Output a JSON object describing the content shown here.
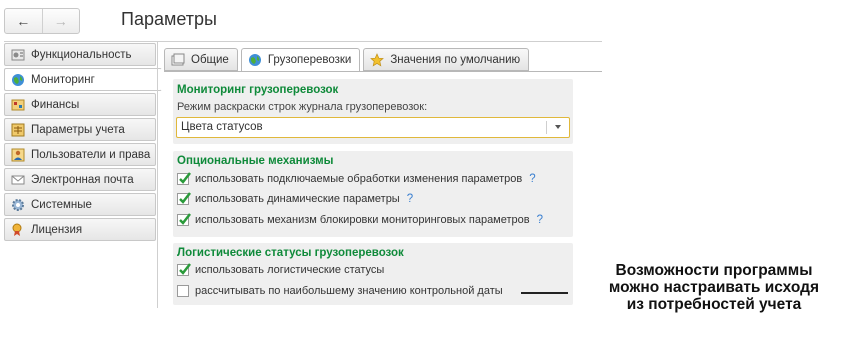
{
  "window": {
    "title": "Параметры"
  },
  "nav": {
    "back_glyph": "←",
    "forward_glyph": "→"
  },
  "sidebar": {
    "items": [
      {
        "label": "Функциональность",
        "icon": "gear-list-icon"
      },
      {
        "label": "Мониторинг",
        "icon": "globe-icon",
        "active": true
      },
      {
        "label": "Финансы",
        "icon": "finance-icon"
      },
      {
        "label": "Параметры учета",
        "icon": "ledger-icon"
      },
      {
        "label": "Пользователи и права",
        "icon": "users-icon"
      },
      {
        "label": "Электронная почта",
        "icon": "envelope-icon"
      },
      {
        "label": "Системные",
        "icon": "system-gear-icon"
      },
      {
        "label": "Лицензия",
        "icon": "license-icon"
      }
    ]
  },
  "tabs": [
    {
      "label": "Общие",
      "icon": "general-icon"
    },
    {
      "label": "Грузоперевозки",
      "icon": "globe-icon",
      "active": true
    },
    {
      "label": "Значения по умолчанию",
      "icon": "star-icon"
    }
  ],
  "monitoring": {
    "title": "Мониторинг грузоперевозок",
    "field_label": "Режим раскраски строк журнала грузоперевозок:",
    "select_value": "Цвета статусов"
  },
  "optional": {
    "title": "Опциональные механизмы",
    "items": [
      {
        "label": "использовать подключаемые обработки изменения параметров",
        "checked": true,
        "help": "?"
      },
      {
        "label": "использовать динамические параметры",
        "checked": true,
        "help": "?"
      },
      {
        "label": "использовать механизм блокировки мониторинговых параметров",
        "checked": true,
        "help": "?"
      }
    ]
  },
  "logistic": {
    "title": "Логистические статусы грузоперевозок",
    "items": [
      {
        "label": "использовать логистические статусы",
        "checked": true
      },
      {
        "label": "рассчитывать  по наибольшему значению контрольной даты",
        "checked": false
      }
    ]
  },
  "callout": {
    "line1": "Возможности программы",
    "line2": "можно настраивать исходя",
    "line3": "из потребностей учета"
  },
  "colors": {
    "accent_green": "#0f8a3a",
    "focus_border": "#e0b83b",
    "help_blue": "#3a7fd0"
  }
}
